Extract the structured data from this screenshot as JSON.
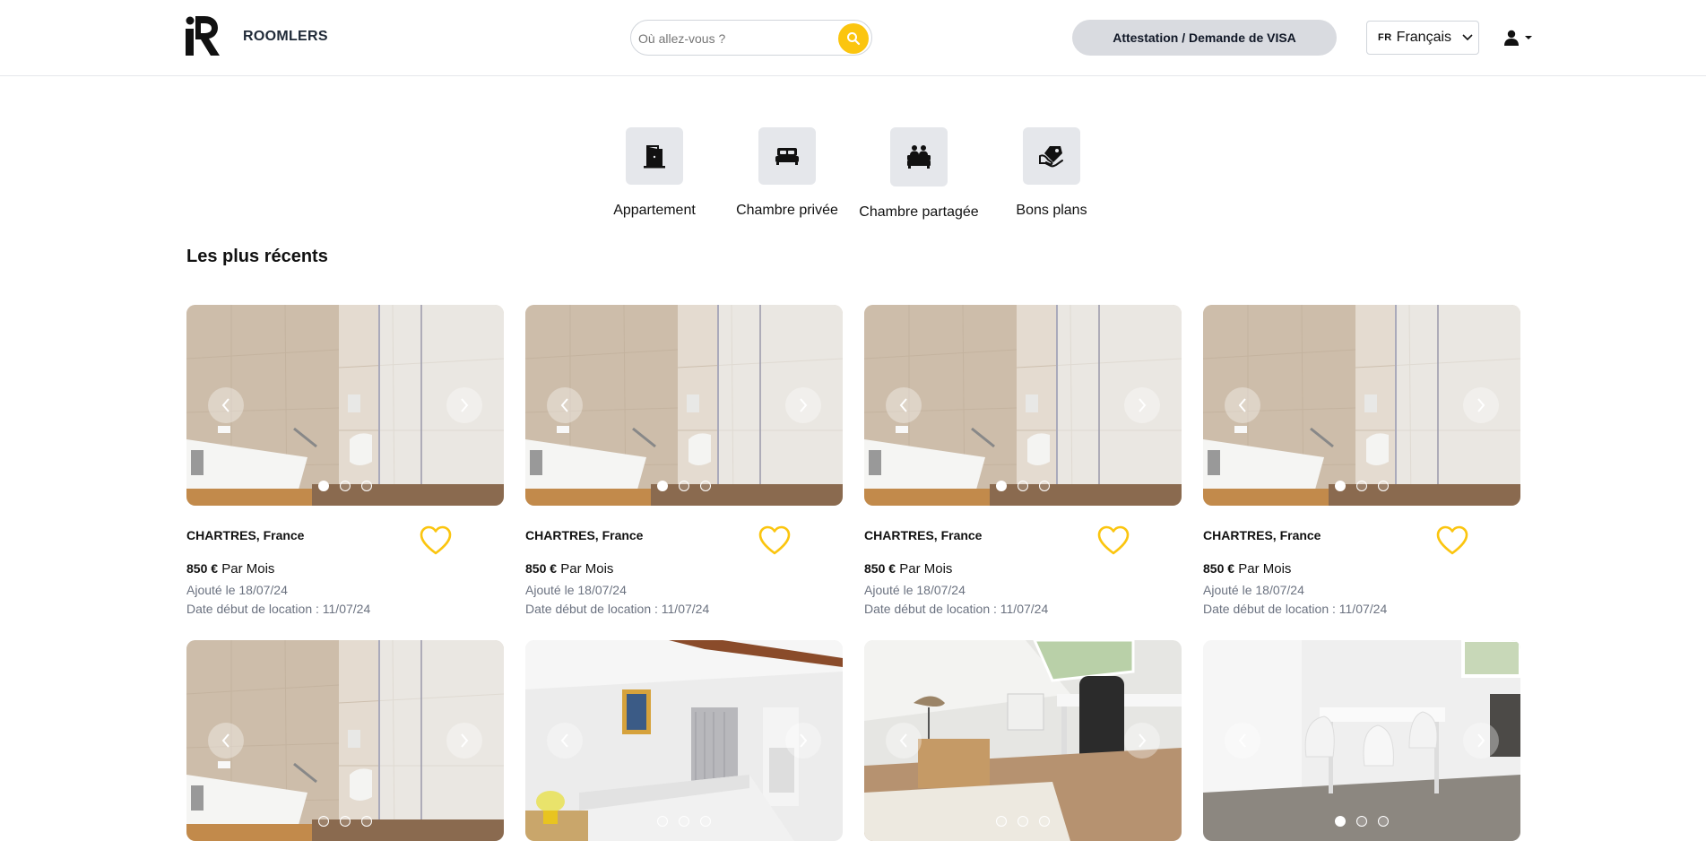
{
  "header": {
    "brand": "ROOMLERS",
    "search_placeholder": "Où allez-vous ?",
    "visa_button": "Attestation / Demande de VISA",
    "lang_code": "FR",
    "lang_label": "Français"
  },
  "categories": [
    {
      "label": "Appartement",
      "icon": "door-icon"
    },
    {
      "label": "Chambre privée",
      "icon": "bed-icon"
    },
    {
      "label": "Chambre partagée",
      "icon": "shared-bed-icon"
    },
    {
      "label": "Bons plans",
      "icon": "deal-tag-icon"
    }
  ],
  "section_title": "Les plus récents",
  "listings": [
    {
      "city": "CHARTRES,",
      "country": "France",
      "price": "850 €",
      "period": "Par Mois",
      "added": "Ajouté le 18/07/24",
      "start": "Date début de location : 11/07/24",
      "photo": "bathroom",
      "active_dot": 0
    },
    {
      "city": "CHARTRES,",
      "country": "France",
      "price": "850 €",
      "period": "Par Mois",
      "added": "Ajouté le 18/07/24",
      "start": "Date début de location : 11/07/24",
      "photo": "bathroom",
      "active_dot": 0
    },
    {
      "city": "CHARTRES,",
      "country": "France",
      "price": "850 €",
      "period": "Par Mois",
      "added": "Ajouté le 18/07/24",
      "start": "Date début de location : 11/07/24",
      "photo": "bathroom",
      "active_dot": 0
    },
    {
      "city": "CHARTRES,",
      "country": "France",
      "price": "850 €",
      "period": "Par Mois",
      "added": "Ajouté le 18/07/24",
      "start": "Date début de location : 11/07/24",
      "photo": "bathroom",
      "active_dot": 0
    },
    {
      "photo": "bathroom",
      "active_dot": -1
    },
    {
      "photo": "bedroom",
      "active_dot": -1
    },
    {
      "photo": "attic-room",
      "active_dot": -1
    },
    {
      "photo": "dining",
      "active_dot": 0
    }
  ],
  "colors": {
    "accent": "#fbc50f",
    "visa_bg": "#d9dbe0",
    "category_bg": "#e5e7eb"
  }
}
